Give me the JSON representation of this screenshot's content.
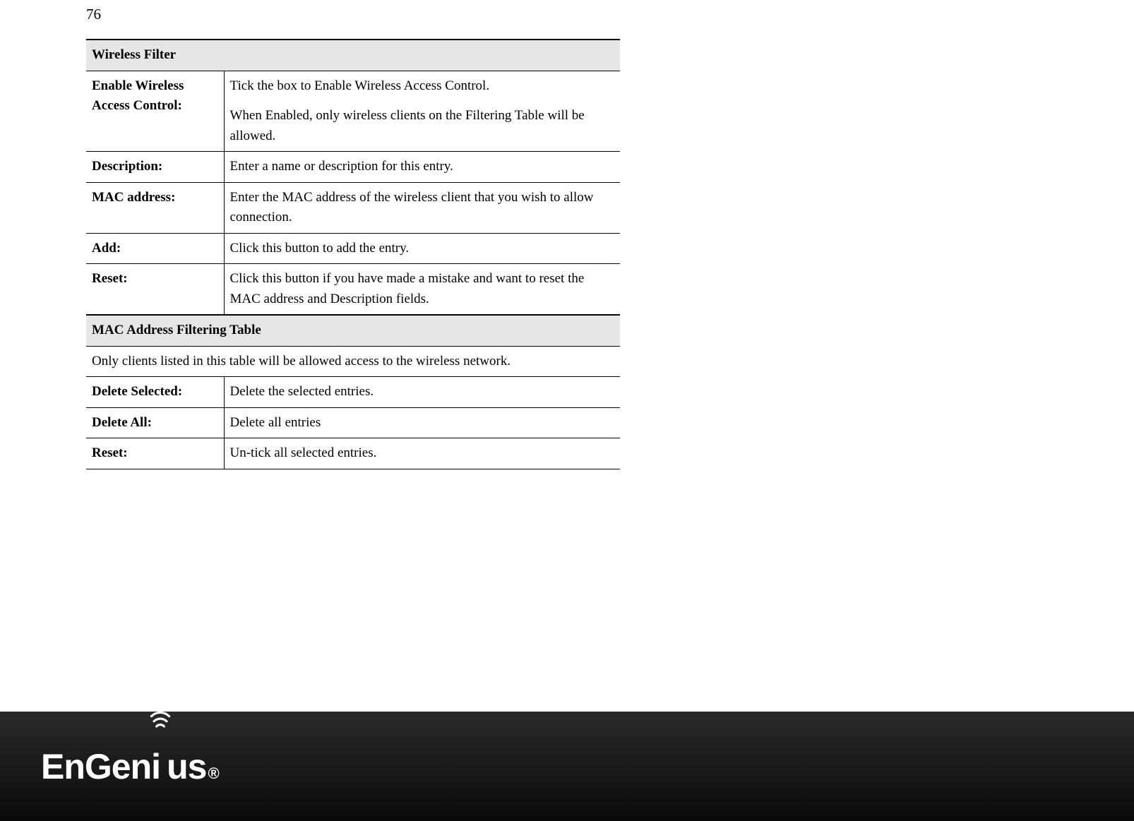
{
  "page_number": "76",
  "sections": {
    "wireless_filter": {
      "header": "Wireless Filter",
      "rows": [
        {
          "label": "Enable Wireless Access Control:",
          "value_line1": "Tick the box to Enable Wireless Access Control.",
          "value_line2": "When Enabled, only wireless clients on the Filtering Table will be allowed."
        },
        {
          "label": "Description:",
          "value": "Enter a name or description for this entry."
        },
        {
          "label": "MAC address:",
          "value": "Enter the MAC address of the wireless client that you wish to allow connection."
        },
        {
          "label": "Add:",
          "value": "Click this button to add the entry."
        },
        {
          "label": "Reset:",
          "value": "Click this button if you have made a mistake and want to reset the MAC address and Description fields."
        }
      ]
    },
    "mac_table": {
      "header": "MAC Address Filtering Table",
      "note": "Only clients listed in this table will be allowed access to the wireless network.",
      "rows": [
        {
          "label": "Delete Selected:",
          "value": "Delete the selected entries."
        },
        {
          "label": "Delete All:",
          "value": "Delete all entries"
        },
        {
          "label": "Reset:",
          "value": "Un-tick all selected entries."
        }
      ]
    }
  },
  "logo": {
    "part1": "EnGen",
    "part2": "us",
    "reg": "®"
  }
}
